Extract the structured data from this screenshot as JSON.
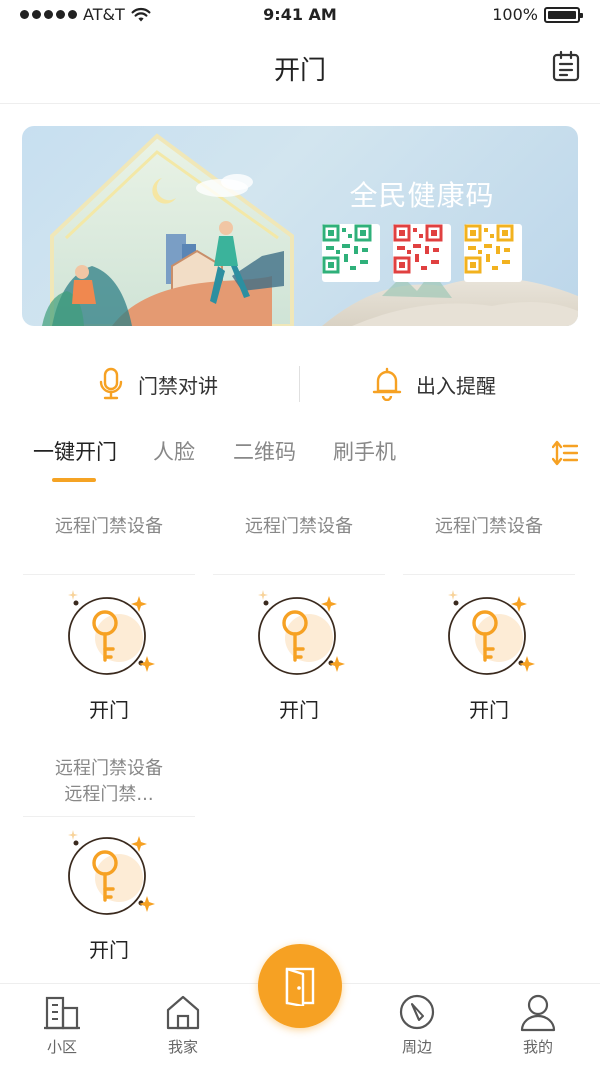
{
  "status_bar": {
    "carrier": "AT&T",
    "time": "9:41 AM",
    "battery": "100%"
  },
  "nav": {
    "title": "开门"
  },
  "banner": {
    "title": "全民健康码"
  },
  "quick_actions": [
    {
      "label": "门禁对讲",
      "icon": "microphone-icon"
    },
    {
      "label": "出入提醒",
      "icon": "bell-icon"
    }
  ],
  "tabs": [
    {
      "label": "一键开门",
      "active": true
    },
    {
      "label": "人脸"
    },
    {
      "label": "二维码"
    },
    {
      "label": "刷手机"
    }
  ],
  "devices": [
    {
      "name": "远程门禁设备",
      "action": "开门"
    },
    {
      "name": "远程门禁设备",
      "action": "开门"
    },
    {
      "name": "远程门禁设备",
      "action": "开门"
    },
    {
      "name_line1": "远程门禁设备",
      "name_line2": "远程门禁...",
      "action": "开门"
    }
  ],
  "bottom_tabs": [
    {
      "label": "小区",
      "icon": "building-icon"
    },
    {
      "label": "我家",
      "icon": "home-icon"
    },
    {
      "label": "周边",
      "icon": "compass-icon"
    },
    {
      "label": "我的",
      "icon": "user-icon"
    }
  ],
  "colors": {
    "accent": "#f6a123",
    "qr_green": "#2fb07a",
    "qr_red": "#e04040",
    "qr_yellow": "#f2b21f"
  }
}
